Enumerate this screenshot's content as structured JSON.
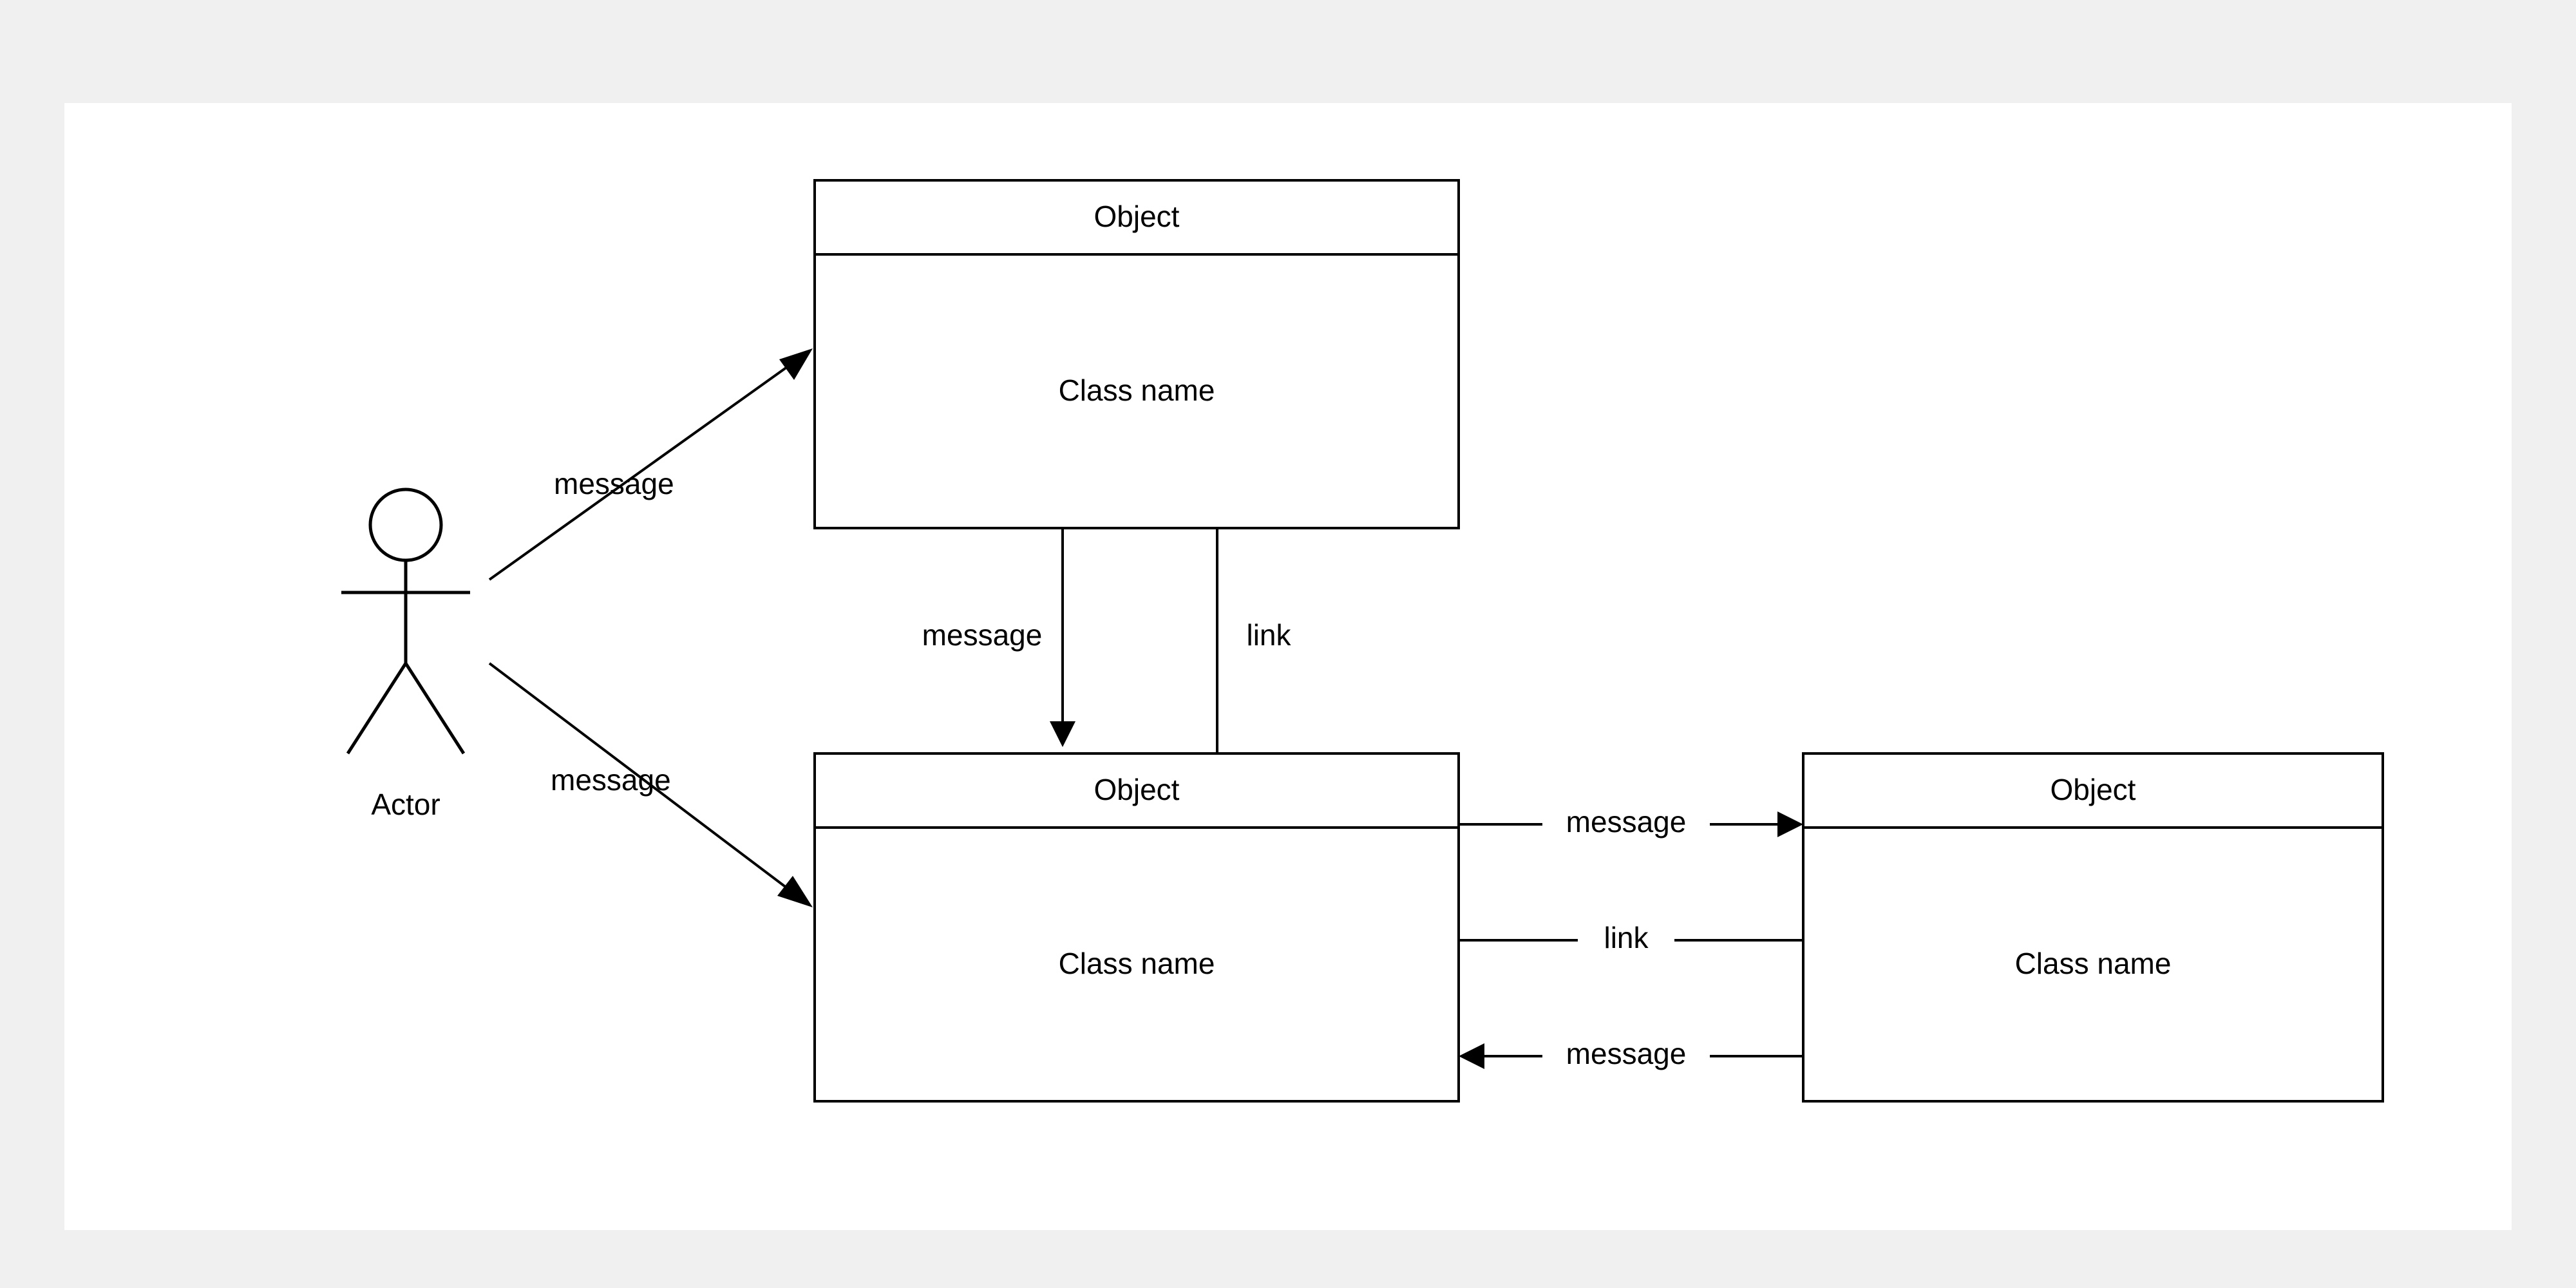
{
  "actor": {
    "label": "Actor"
  },
  "objects": [
    {
      "header": "Object",
      "body": "Class name"
    },
    {
      "header": "Object",
      "body": "Class name"
    },
    {
      "header": "Object",
      "body": "Class name"
    }
  ],
  "connections": {
    "actor_to_obj1": "message",
    "actor_to_obj2": "message",
    "obj1_to_obj2_arrow": "message",
    "obj1_to_obj2_link": "link",
    "obj2_to_obj3_top": "message",
    "obj2_to_obj3_mid": "link",
    "obj3_to_obj2_bot": "message"
  }
}
